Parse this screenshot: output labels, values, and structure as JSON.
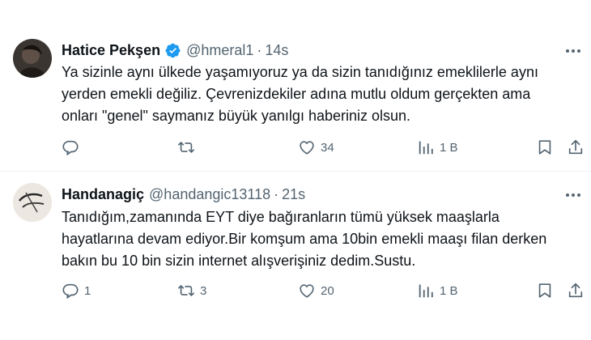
{
  "tweets": [
    {
      "name": "Hatice Pekşen",
      "verified": true,
      "handle": "@hmeral1",
      "separator": "·",
      "time": "14s",
      "text": "Ya sizinle aynı ülkede yaşamıyoruz ya da sizin tanıdığınız emeklilerle aynı\nyerden emekli değiliz. Çevrenizdekiler adına mutlu oldum gerçekten ama\nonları \"genel\" saymanız büyük yanılgı haberiniz olsun.",
      "replies": "",
      "retweets": "",
      "likes": "34",
      "views": "1 B"
    },
    {
      "name": "Handanagiç",
      "verified": false,
      "handle": "@handangic13118",
      "separator": "·",
      "time": "21s",
      "text": "Tanıdığım,zamanında EYT diye bağıranların tümü yüksek maaşlarla\nhayatlarına devam ediyor.Bir komşum ama 10bin emekli maaşı filan derken\nbakın bu 10 bin sizin internet alışverişiniz dedim.Sustu.",
      "replies": "1",
      "retweets": "3",
      "likes": "20",
      "views": "1 B"
    }
  ],
  "colors": {
    "text": "#0f1419",
    "secondary": "#536471",
    "verified": "#1d9bf0",
    "divider": "#eff3f4"
  },
  "icons": [
    "more-icon",
    "reply-icon",
    "retweet-icon",
    "like-icon",
    "views-icon",
    "bookmark-icon",
    "share-icon",
    "verified-icon"
  ]
}
